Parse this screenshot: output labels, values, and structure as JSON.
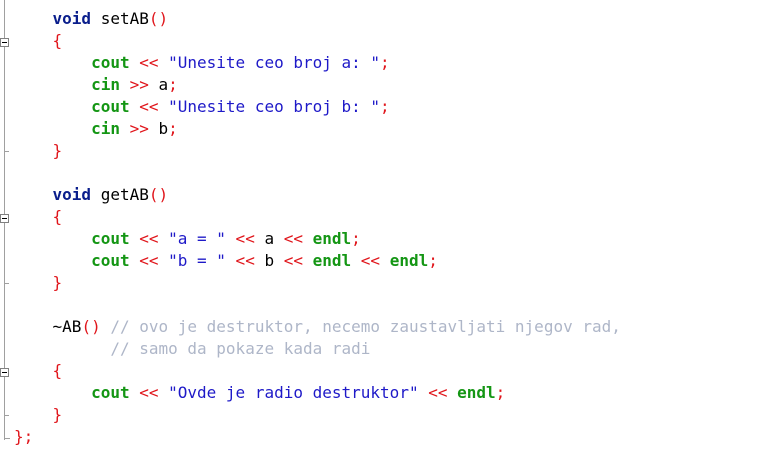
{
  "theme": {
    "keyword": "#0a1e8c",
    "operator": "#e0151b",
    "string": "#1e19c8",
    "stream": "#149614",
    "comment": "#aeb6c8",
    "text": "#000000"
  },
  "code": {
    "lines": [
      [
        {
          "t": "    "
        },
        {
          "t": "void",
          "c": "kw"
        },
        {
          "t": " setAB",
          "c": "plain"
        },
        {
          "t": "()",
          "c": "op"
        }
      ],
      [
        {
          "t": "    "
        },
        {
          "t": "{",
          "c": "op"
        }
      ],
      [
        {
          "t": "        "
        },
        {
          "t": "cout",
          "c": "stream"
        },
        {
          "t": " << ",
          "c": "op"
        },
        {
          "t": "\"Unesite ceo broj a: \"",
          "c": "str"
        },
        {
          "t": ";",
          "c": "op"
        }
      ],
      [
        {
          "t": "        "
        },
        {
          "t": "cin",
          "c": "stream"
        },
        {
          "t": " >> ",
          "c": "op"
        },
        {
          "t": "a",
          "c": "plain"
        },
        {
          "t": ";",
          "c": "op"
        }
      ],
      [
        {
          "t": "        "
        },
        {
          "t": "cout",
          "c": "stream"
        },
        {
          "t": " << ",
          "c": "op"
        },
        {
          "t": "\"Unesite ceo broj b: \"",
          "c": "str"
        },
        {
          "t": ";",
          "c": "op"
        }
      ],
      [
        {
          "t": "        "
        },
        {
          "t": "cin",
          "c": "stream"
        },
        {
          "t": " >> ",
          "c": "op"
        },
        {
          "t": "b",
          "c": "plain"
        },
        {
          "t": ";",
          "c": "op"
        }
      ],
      [
        {
          "t": "    "
        },
        {
          "t": "}",
          "c": "op"
        }
      ],
      [],
      [
        {
          "t": "    "
        },
        {
          "t": "void",
          "c": "kw"
        },
        {
          "t": " getAB",
          "c": "plain"
        },
        {
          "t": "()",
          "c": "op"
        }
      ],
      [
        {
          "t": "    "
        },
        {
          "t": "{",
          "c": "op"
        }
      ],
      [
        {
          "t": "        "
        },
        {
          "t": "cout",
          "c": "stream"
        },
        {
          "t": " << ",
          "c": "op"
        },
        {
          "t": "\"a = \"",
          "c": "str"
        },
        {
          "t": " << ",
          "c": "op"
        },
        {
          "t": "a",
          "c": "plain"
        },
        {
          "t": " << ",
          "c": "op"
        },
        {
          "t": "endl",
          "c": "stream"
        },
        {
          "t": ";",
          "c": "op"
        }
      ],
      [
        {
          "t": "        "
        },
        {
          "t": "cout",
          "c": "stream"
        },
        {
          "t": " << ",
          "c": "op"
        },
        {
          "t": "\"b = \"",
          "c": "str"
        },
        {
          "t": " << ",
          "c": "op"
        },
        {
          "t": "b",
          "c": "plain"
        },
        {
          "t": " << ",
          "c": "op"
        },
        {
          "t": "endl",
          "c": "stream"
        },
        {
          "t": " << ",
          "c": "op"
        },
        {
          "t": "endl",
          "c": "stream"
        },
        {
          "t": ";",
          "c": "op"
        }
      ],
      [
        {
          "t": "    "
        },
        {
          "t": "}",
          "c": "op"
        }
      ],
      [],
      [
        {
          "t": "    "
        },
        {
          "t": "~AB",
          "c": "plain"
        },
        {
          "t": "()",
          "c": "op"
        },
        {
          "t": " // ovo je destruktor, necemo zaustavljati njegov rad,",
          "c": "cmt"
        }
      ],
      [
        {
          "t": "          "
        },
        {
          "t": "// samo da pokaze kada radi",
          "c": "cmt"
        }
      ],
      [
        {
          "t": "    "
        },
        {
          "t": "{",
          "c": "op"
        }
      ],
      [
        {
          "t": "        "
        },
        {
          "t": "cout",
          "c": "stream"
        },
        {
          "t": " << ",
          "c": "op"
        },
        {
          "t": "\"Ovde je radio destruktor\"",
          "c": "str"
        },
        {
          "t": " << ",
          "c": "op"
        },
        {
          "t": "endl",
          "c": "stream"
        },
        {
          "t": ";",
          "c": "op"
        }
      ],
      [
        {
          "t": "    "
        },
        {
          "t": "}",
          "c": "op"
        }
      ],
      [
        {
          "t": "}",
          "c": "op"
        },
        {
          "t": ";",
          "c": "op"
        }
      ]
    ]
  }
}
